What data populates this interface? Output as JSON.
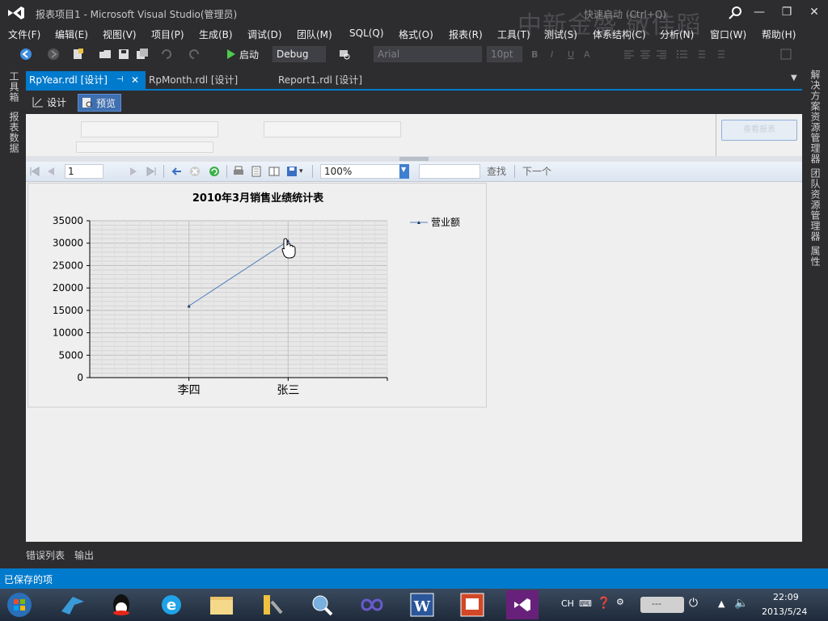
{
  "window": {
    "title": "报表项目1 - Microsoft Visual Studio(管理员)",
    "quick_launch": "快速启动 (Ctrl+Q)",
    "watermark": "中新金盛 敬佳蹈",
    "minimize": "—",
    "restore": "❐",
    "close": "✕"
  },
  "menu": [
    "文件(F)",
    "编辑(E)",
    "视图(V)",
    "项目(P)",
    "生成(B)",
    "调试(D)",
    "团队(M)",
    "SQL(Q)",
    "格式(O)",
    "报表(R)",
    "工具(T)",
    "测试(S)",
    "体系结构(C)",
    "分析(N)",
    "窗口(W)",
    "帮助(H)"
  ],
  "toolbar": {
    "start_label": "启动",
    "config": "Debug",
    "font": "Arial",
    "font_size": "10pt"
  },
  "left_panel": {
    "toolbox": "工具箱",
    "report_data": "报表数据"
  },
  "right_panel": {
    "solution_explorer": "解决方案资源管理器",
    "team_explorer": "团队资源管理器",
    "properties": "属性"
  },
  "doc_tabs": [
    {
      "label": "RpYear.rdl [设计]",
      "active": true
    },
    {
      "label": "RpMonth.rdl [设计]",
      "active": false
    },
    {
      "label": "Report1.rdl [设计]",
      "active": false
    }
  ],
  "design_bar": {
    "design": "设计",
    "preview": "预览"
  },
  "params": {
    "view_report": "查看报表"
  },
  "report_toolbar": {
    "page": "1",
    "zoom": "100%",
    "find": "查找",
    "next": "下一个"
  },
  "chart_data": {
    "type": "line",
    "title": "2010年3月销售业绩统计表",
    "categories": [
      "李四",
      "张三"
    ],
    "series": [
      {
        "name": "营业额",
        "values": [
          16000,
          30500
        ]
      }
    ],
    "ylim": [
      0,
      35000
    ],
    "yticks": [
      "35000",
      "30000",
      "25000",
      "20000",
      "15000",
      "10000",
      "5000",
      "0"
    ],
    "grid": true,
    "legend": "top-right",
    "color": "#4f81bd"
  },
  "bottom_tabs": {
    "errors": "错误列表",
    "output": "输出"
  },
  "status": "已保存的项",
  "taskbar": {
    "lang": "CH",
    "time": "22:09",
    "date": "2013/5/24"
  },
  "colors": {
    "accent": "#007acc",
    "chrome": "#2d2d30"
  }
}
